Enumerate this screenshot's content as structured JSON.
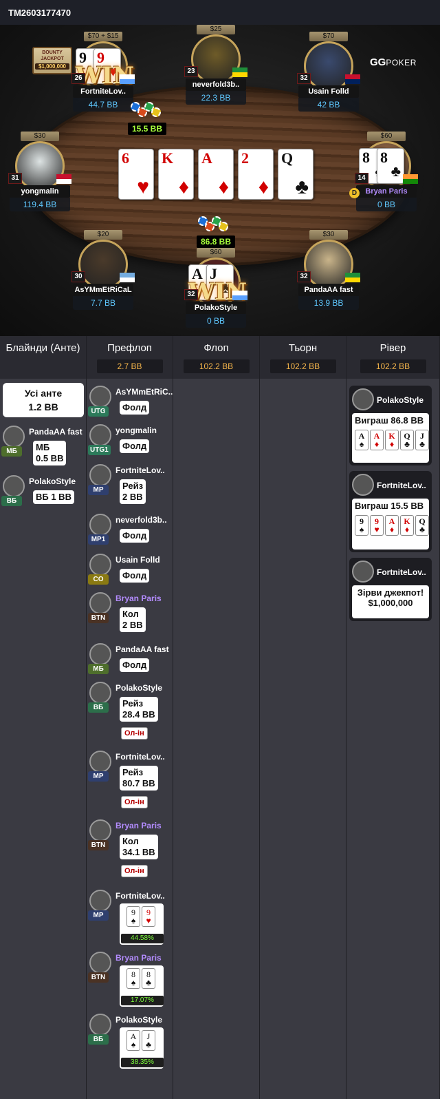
{
  "header": {
    "hand_id": "TM2603177470"
  },
  "brand": {
    "logo_gg": "GG",
    "logo_poker": "POKER"
  },
  "jackpot": {
    "label": "BOUNTY JACKPOT",
    "value": "$1,000,000"
  },
  "win_text": "WIN",
  "board": {
    "cards": [
      {
        "rank": "6",
        "suit": "♥",
        "color": "red"
      },
      {
        "rank": "K",
        "suit": "♦",
        "color": "red"
      },
      {
        "rank": "A",
        "suit": "♦",
        "color": "red"
      },
      {
        "rank": "2",
        "suit": "♦",
        "color": "red"
      },
      {
        "rank": "Q",
        "suit": "♣",
        "color": "black"
      }
    ]
  },
  "pots": {
    "side": "15.5 BB",
    "main": "86.8 BB"
  },
  "seats": [
    {
      "id": "fortnite",
      "stakes": "$70 + $15",
      "level": "26",
      "name": "FortniteLov..",
      "stack": "44.7 BB",
      "hole": [
        {
          "rank": "9",
          "suit": "♠",
          "color": "black"
        },
        {
          "rank": "9",
          "suit": "♥",
          "color": "red"
        }
      ],
      "winner": true
    },
    {
      "id": "neverfold",
      "stakes": "$25",
      "level": "23",
      "name": "neverfold3b..",
      "stack": "22.3 BB"
    },
    {
      "id": "usain",
      "stakes": "$70",
      "level": "32",
      "name": "Usain Folld",
      "stack": "42 BB"
    },
    {
      "id": "yongmalin",
      "stakes": "$30",
      "level": "31",
      "name": "yongmalin",
      "stack": "119.4 BB"
    },
    {
      "id": "bryan",
      "stakes": "$60",
      "level": "14",
      "name": "Bryan Paris",
      "stack": "0 BB",
      "hole": [
        {
          "rank": "8",
          "suit": "♠",
          "color": "black"
        },
        {
          "rank": "8",
          "suit": "♣",
          "color": "black"
        }
      ],
      "dealer": "D"
    },
    {
      "id": "asym",
      "stakes": "$20",
      "level": "30",
      "name": "AsYMmEtRiCaL",
      "stack": "7.7 BB"
    },
    {
      "id": "polako",
      "stakes": "$60",
      "level": "32",
      "name": "PolakoStyle",
      "stack": "0 BB",
      "hole": [
        {
          "rank": "A",
          "suit": "♠",
          "color": "black"
        },
        {
          "rank": "J",
          "suit": "♣",
          "color": "black"
        }
      ],
      "winner": true
    },
    {
      "id": "panda",
      "stakes": "$30",
      "level": "32",
      "name": "PandaAA fast",
      "stack": "13.9 BB"
    }
  ],
  "columns": [
    {
      "title": "Блайнди (Анте)",
      "pot": ""
    },
    {
      "title": "Префлоп",
      "pot": "2.7 BB"
    },
    {
      "title": "Флоп",
      "pot": "102.2 BB"
    },
    {
      "title": "Тьорн",
      "pot": "102.2 BB"
    },
    {
      "title": "Рівер",
      "pot": "102.2 BB"
    }
  ],
  "blinds": {
    "ante_label": "Усі анте",
    "ante_value": "1.2 BB",
    "actions": [
      {
        "name": "PandaAA fast",
        "pos": "МБ",
        "line1": "МБ",
        "line2": "0.5 BB"
      },
      {
        "name": "PolakoStyle",
        "pos": "ВБ",
        "line1": "ВБ 1 BB",
        "line2": ""
      }
    ]
  },
  "preflop": [
    {
      "name": "AsYMmEtRiC..",
      "pos": "UTG",
      "line1": "Фолд",
      "line2": ""
    },
    {
      "name": "yongmalin",
      "pos": "UTG1",
      "line1": "Фолд",
      "line2": ""
    },
    {
      "name": "FortniteLov..",
      "pos": "MP",
      "line1": "Рейз",
      "line2": "2 BB"
    },
    {
      "name": "neverfold3b..",
      "pos": "MP1",
      "line1": "Фолд",
      "line2": ""
    },
    {
      "name": "Usain Folld",
      "pos": "CO",
      "line1": "Фолд",
      "line2": ""
    },
    {
      "name": "Bryan Paris",
      "pos": "BTN",
      "line1": "Кол",
      "line2": "2 BB"
    },
    {
      "name": "PandaAA fast",
      "pos": "МБ",
      "line1": "Фолд",
      "line2": ""
    },
    {
      "name": "PolakoStyle",
      "pos": "ВБ",
      "line1": "Рейз",
      "line2": "28.4 BB",
      "allin": "Ол-ін"
    },
    {
      "name": "FortniteLov..",
      "pos": "MP",
      "line1": "Рейз",
      "line2": "80.7 BB",
      "allin": "Ол-ін"
    },
    {
      "name": "Bryan Paris",
      "pos": "BTN",
      "line1": "Кол",
      "line2": "34.1 BB",
      "allin": "Ол-ін"
    }
  ],
  "showdown": [
    {
      "name": "FortniteLov..",
      "pos": "MP",
      "cards": [
        {
          "rank": "9",
          "suit": "♠",
          "color": "black"
        },
        {
          "rank": "9",
          "suit": "♥",
          "color": "red"
        }
      ],
      "equity": "44.58%"
    },
    {
      "name": "Bryan Paris",
      "pos": "BTN",
      "cards": [
        {
          "rank": "8",
          "suit": "♠",
          "color": "black"
        },
        {
          "rank": "8",
          "suit": "♣",
          "color": "black"
        }
      ],
      "equity": "17.07%"
    },
    {
      "name": "PolakoStyle",
      "pos": "ВБ",
      "cards": [
        {
          "rank": "A",
          "suit": "♠",
          "color": "black"
        },
        {
          "rank": "J",
          "suit": "♣",
          "color": "black"
        }
      ],
      "equity": "38.35%"
    }
  ],
  "river": [
    {
      "name": "PolakoStyle",
      "text": "Виграш 86.8 BB",
      "cards": [
        {
          "rank": "A",
          "suit": "♠",
          "color": "black"
        },
        {
          "rank": "A",
          "suit": "♦",
          "color": "red"
        },
        {
          "rank": "K",
          "suit": "♦",
          "color": "red"
        },
        {
          "rank": "Q",
          "suit": "♣",
          "color": "black"
        },
        {
          "rank": "J",
          "suit": "♣",
          "color": "black"
        }
      ]
    },
    {
      "name": "FortniteLov..",
      "text": "Виграш 15.5 BB",
      "cards": [
        {
          "rank": "9",
          "suit": "♠",
          "color": "black"
        },
        {
          "rank": "9",
          "suit": "♥",
          "color": "red"
        },
        {
          "rank": "A",
          "suit": "♦",
          "color": "red"
        },
        {
          "rank": "K",
          "suit": "♦",
          "color": "red"
        },
        {
          "rank": "Q",
          "suit": "♣",
          "color": "black"
        }
      ]
    },
    {
      "name": "FortniteLov..",
      "text": "Зірви джекпот!",
      "text2": "$1,000,000"
    }
  ],
  "colors": {
    "accent_gold": "#f0b24a",
    "stack_blue": "#5fc8ff",
    "pot_green": "#a7ff3b",
    "purple_name": "#b48cff"
  }
}
